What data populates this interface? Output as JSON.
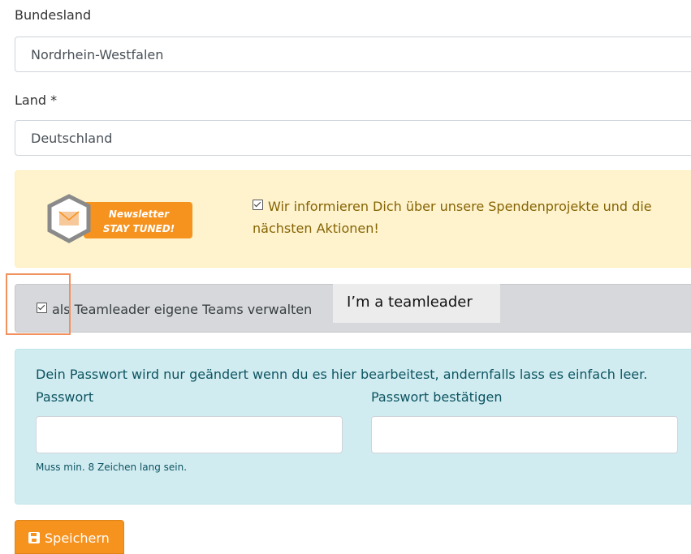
{
  "bundesland": {
    "label": "Bundesland",
    "selected": "Nordrhein-Westfalen"
  },
  "land": {
    "label": "Land *",
    "selected": "Deutschland"
  },
  "newsletter": {
    "badge_line1": "Newsletter",
    "badge_line2": "STAY TUNED!",
    "checkbox_checked": true,
    "text": "Wir informieren Dich über unsere Spendenprojekte und die nächsten Aktionen!"
  },
  "teamleader": {
    "checkbox_checked": true,
    "label": "als Teamleader eigene Teams verwalten",
    "tooltip": "I’m a teamleader"
  },
  "password": {
    "info": "Dein Passwort wird nur geändert wenn du es hier bearbeitest, andernfalls lass es einfach leer.",
    "password_label": "Passwort",
    "confirm_label": "Passwort bestätigen",
    "hint": "Muss min. 8 Zeichen lang sein."
  },
  "save": {
    "label": "Speichern",
    "icon": "floppy-disk-icon"
  },
  "colors": {
    "newsletter_bg": "#fff3cd",
    "newsletter_text": "#856404",
    "teambar_bg": "#d6d8db",
    "info_bg": "#d1ecf1",
    "info_text": "#0c5460",
    "save_button": "#f6921e",
    "highlight_border": "#f0915e"
  }
}
